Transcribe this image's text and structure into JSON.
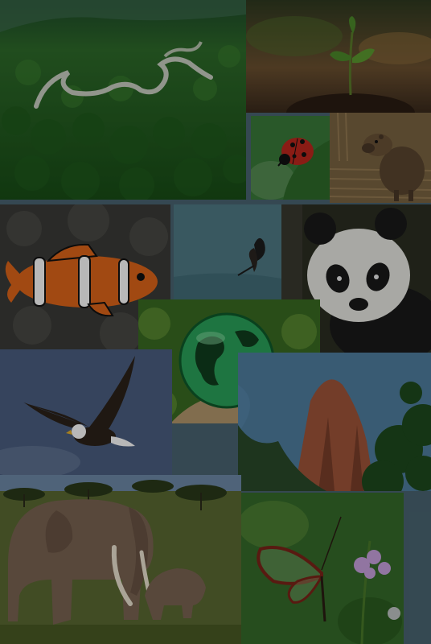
{
  "collage": {
    "background": "#4a6572",
    "tiles": [
      {
        "subject": "river-forest-aerial",
        "colors": [
          "#0f3a1a",
          "#2e6b2a",
          "#b9c4b0"
        ]
      },
      {
        "subject": "seedling-in-soil",
        "colors": [
          "#3a2a1c",
          "#8a6a3a",
          "#4d8a2a"
        ]
      },
      {
        "subject": "ladybug-on-leaf",
        "colors": [
          "#2f6b3a",
          "#c0271e",
          "#111111"
        ]
      },
      {
        "subject": "capybara-in-water",
        "colors": [
          "#6a5638",
          "#a88a5e",
          "#403324"
        ]
      },
      {
        "subject": "clownfish",
        "colors": [
          "#3b3b38",
          "#e0661a",
          "#ffffff"
        ]
      },
      {
        "subject": "butterfly-silhouette",
        "colors": [
          "#4f7a86",
          "#1c1c1c"
        ]
      },
      {
        "subject": "giant-panda",
        "colors": [
          "#1a1a1a",
          "#e9e9e4",
          "#2b2f22"
        ]
      },
      {
        "subject": "glass-earth-globe",
        "colors": [
          "#2f6b1e",
          "#2aa35a",
          "#103e1e"
        ]
      },
      {
        "subject": "bald-eagle",
        "colors": [
          "#4b5f82",
          "#2b2219",
          "#ffffff"
        ]
      },
      {
        "subject": "red-canyon-trees",
        "colors": [
          "#4f7ea0",
          "#a0553a",
          "#1e4a1e"
        ]
      },
      {
        "subject": "elephants-savanna",
        "colors": [
          "#6e8aa8",
          "#7a6452",
          "#5a6a32"
        ]
      },
      {
        "subject": "glasswing-butterfly",
        "colors": [
          "#356b2a",
          "#7a2418",
          "#c9a2e0"
        ]
      }
    ]
  }
}
